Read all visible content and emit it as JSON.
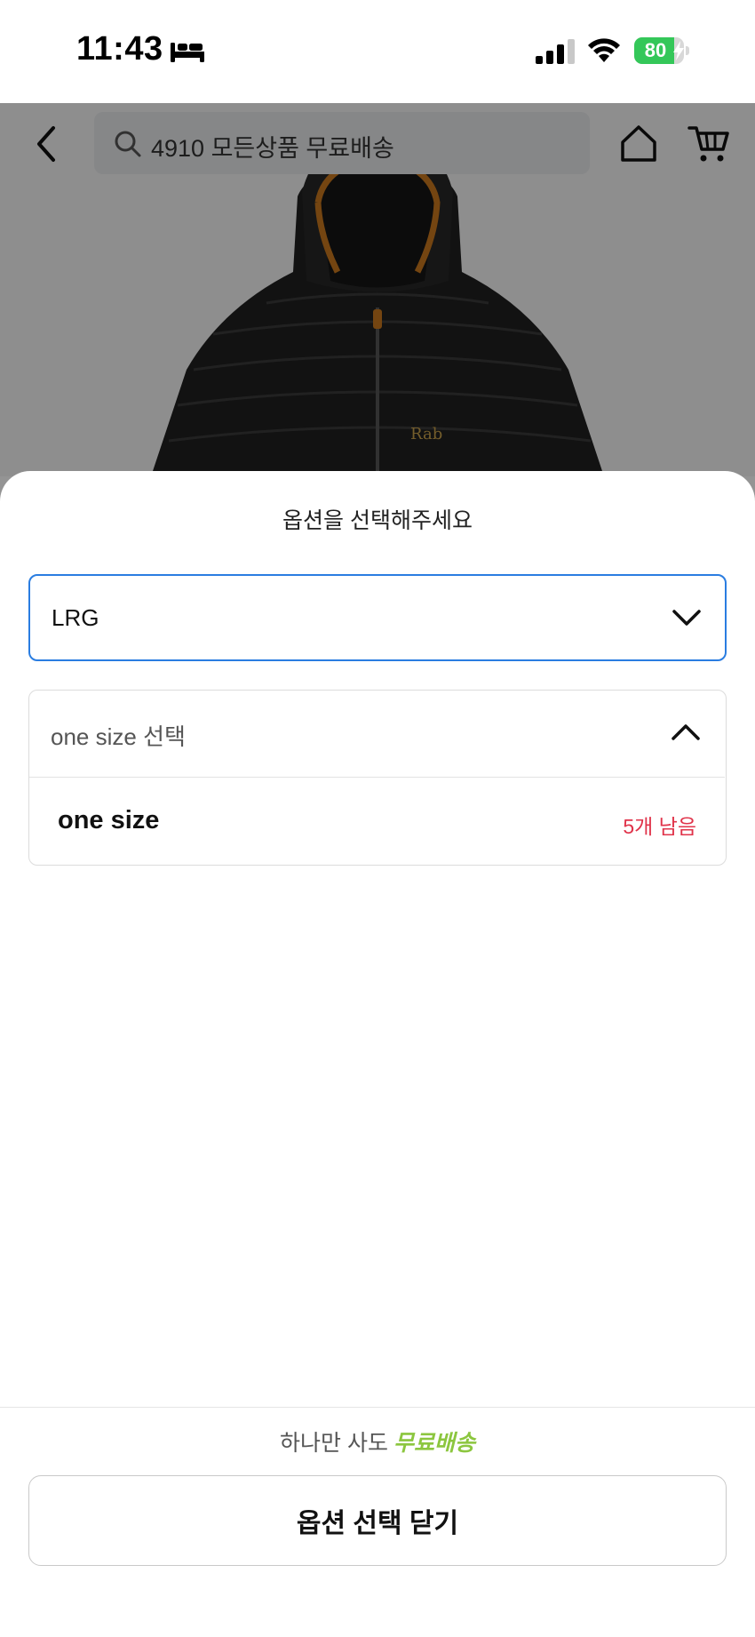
{
  "status_bar": {
    "time": "11:43",
    "battery_percent": "80",
    "battery_level": 0.8,
    "icons": [
      "bed-icon",
      "signal-icon",
      "wifi-icon",
      "battery-icon"
    ]
  },
  "header": {
    "search_text": "4910 모든상품 무료배송",
    "icons": [
      "back-arrow-icon",
      "search-icon",
      "home-icon",
      "cart-icon"
    ]
  },
  "product": {
    "brand_mark": "Rab"
  },
  "option_sheet": {
    "title": "옵션을 선택해주세요",
    "first_select": {
      "value": "LRG"
    },
    "second_select": {
      "placeholder": "one size 선택",
      "options": [
        {
          "name": "one size",
          "stock": "5개 남음"
        }
      ]
    },
    "footer": {
      "promo_prefix": "하나만 사도",
      "promo_highlight": "무료배송",
      "close_label": "옵션 선택 닫기"
    }
  },
  "colors": {
    "accent_border": "#2a7de1",
    "stock_red": "#e0334a",
    "promo_green": "#8cc63f",
    "battery_green": "#34c759"
  }
}
